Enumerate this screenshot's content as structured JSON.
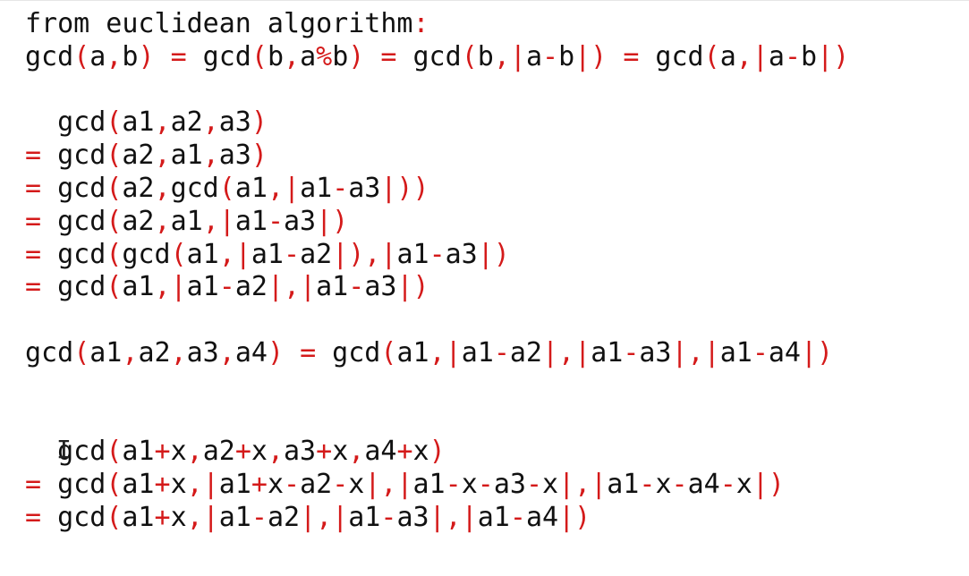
{
  "colors": {
    "background": "#ffffff",
    "text": "#111111",
    "operator": "#d41a1a"
  },
  "lines": [
    [
      {
        "t": "from euclidean algorithm",
        "c": "k"
      },
      {
        "t": ":",
        "c": "r"
      }
    ],
    [
      {
        "t": "gcd",
        "c": "k"
      },
      {
        "t": "(",
        "c": "r"
      },
      {
        "t": "a",
        "c": "k"
      },
      {
        "t": ",",
        "c": "r"
      },
      {
        "t": "b",
        "c": "k"
      },
      {
        "t": ")",
        "c": "r"
      },
      {
        "t": " ",
        "c": "k"
      },
      {
        "t": "=",
        "c": "r"
      },
      {
        "t": " gcd",
        "c": "k"
      },
      {
        "t": "(",
        "c": "r"
      },
      {
        "t": "b",
        "c": "k"
      },
      {
        "t": ",",
        "c": "r"
      },
      {
        "t": "a",
        "c": "k"
      },
      {
        "t": "%",
        "c": "r"
      },
      {
        "t": "b",
        "c": "k"
      },
      {
        "t": ")",
        "c": "r"
      },
      {
        "t": " ",
        "c": "k"
      },
      {
        "t": "=",
        "c": "r"
      },
      {
        "t": " gcd",
        "c": "k"
      },
      {
        "t": "(",
        "c": "r"
      },
      {
        "t": "b",
        "c": "k"
      },
      {
        "t": ",|",
        "c": "r"
      },
      {
        "t": "a",
        "c": "k"
      },
      {
        "t": "-",
        "c": "r"
      },
      {
        "t": "b",
        "c": "k"
      },
      {
        "t": "|)",
        "c": "r"
      },
      {
        "t": " ",
        "c": "k"
      },
      {
        "t": "=",
        "c": "r"
      },
      {
        "t": " gcd",
        "c": "k"
      },
      {
        "t": "(",
        "c": "r"
      },
      {
        "t": "a",
        "c": "k"
      },
      {
        "t": ",|",
        "c": "r"
      },
      {
        "t": "a",
        "c": "k"
      },
      {
        "t": "-",
        "c": "r"
      },
      {
        "t": "b",
        "c": "k"
      },
      {
        "t": "|)",
        "c": "r"
      }
    ],
    [],
    [
      {
        "t": "  gcd",
        "c": "k"
      },
      {
        "t": "(",
        "c": "r"
      },
      {
        "t": "a1",
        "c": "k"
      },
      {
        "t": ",",
        "c": "r"
      },
      {
        "t": "a2",
        "c": "k"
      },
      {
        "t": ",",
        "c": "r"
      },
      {
        "t": "a3",
        "c": "k"
      },
      {
        "t": ")",
        "c": "r"
      }
    ],
    [
      {
        "t": "=",
        "c": "r"
      },
      {
        "t": " gcd",
        "c": "k"
      },
      {
        "t": "(",
        "c": "r"
      },
      {
        "t": "a2",
        "c": "k"
      },
      {
        "t": ",",
        "c": "r"
      },
      {
        "t": "a1",
        "c": "k"
      },
      {
        "t": ",",
        "c": "r"
      },
      {
        "t": "a3",
        "c": "k"
      },
      {
        "t": ")",
        "c": "r"
      }
    ],
    [
      {
        "t": "=",
        "c": "r"
      },
      {
        "t": " gcd",
        "c": "k"
      },
      {
        "t": "(",
        "c": "r"
      },
      {
        "t": "a2",
        "c": "k"
      },
      {
        "t": ",",
        "c": "r"
      },
      {
        "t": "gcd",
        "c": "k"
      },
      {
        "t": "(",
        "c": "r"
      },
      {
        "t": "a1",
        "c": "k"
      },
      {
        "t": ",|",
        "c": "r"
      },
      {
        "t": "a1",
        "c": "k"
      },
      {
        "t": "-",
        "c": "r"
      },
      {
        "t": "a3",
        "c": "k"
      },
      {
        "t": "|))",
        "c": "r"
      }
    ],
    [
      {
        "t": "=",
        "c": "r"
      },
      {
        "t": " gcd",
        "c": "k"
      },
      {
        "t": "(",
        "c": "r"
      },
      {
        "t": "a2",
        "c": "k"
      },
      {
        "t": ",",
        "c": "r"
      },
      {
        "t": "a1",
        "c": "k"
      },
      {
        "t": ",|",
        "c": "r"
      },
      {
        "t": "a1",
        "c": "k"
      },
      {
        "t": "-",
        "c": "r"
      },
      {
        "t": "a3",
        "c": "k"
      },
      {
        "t": "|)",
        "c": "r"
      }
    ],
    [
      {
        "t": "=",
        "c": "r"
      },
      {
        "t": " gcd",
        "c": "k"
      },
      {
        "t": "(",
        "c": "r"
      },
      {
        "t": "gcd",
        "c": "k"
      },
      {
        "t": "(",
        "c": "r"
      },
      {
        "t": "a1",
        "c": "k"
      },
      {
        "t": ",|",
        "c": "r"
      },
      {
        "t": "a1",
        "c": "k"
      },
      {
        "t": "-",
        "c": "r"
      },
      {
        "t": "a2",
        "c": "k"
      },
      {
        "t": "|),|",
        "c": "r"
      },
      {
        "t": "a1",
        "c": "k"
      },
      {
        "t": "-",
        "c": "r"
      },
      {
        "t": "a3",
        "c": "k"
      },
      {
        "t": "|)",
        "c": "r"
      }
    ],
    [
      {
        "t": "=",
        "c": "r"
      },
      {
        "t": " gcd",
        "c": "k"
      },
      {
        "t": "(",
        "c": "r"
      },
      {
        "t": "a1",
        "c": "k"
      },
      {
        "t": ",|",
        "c": "r"
      },
      {
        "t": "a1",
        "c": "k"
      },
      {
        "t": "-",
        "c": "r"
      },
      {
        "t": "a2",
        "c": "k"
      },
      {
        "t": "|,|",
        "c": "r"
      },
      {
        "t": "a1",
        "c": "k"
      },
      {
        "t": "-",
        "c": "r"
      },
      {
        "t": "a3",
        "c": "k"
      },
      {
        "t": "|)",
        "c": "r"
      }
    ],
    [],
    [
      {
        "t": "gcd",
        "c": "k"
      },
      {
        "t": "(",
        "c": "r"
      },
      {
        "t": "a1",
        "c": "k"
      },
      {
        "t": ",",
        "c": "r"
      },
      {
        "t": "a2",
        "c": "k"
      },
      {
        "t": ",",
        "c": "r"
      },
      {
        "t": "a3",
        "c": "k"
      },
      {
        "t": ",",
        "c": "r"
      },
      {
        "t": "a4",
        "c": "k"
      },
      {
        "t": ")",
        "c": "r"
      },
      {
        "t": " ",
        "c": "k"
      },
      {
        "t": "=",
        "c": "r"
      },
      {
        "t": " gcd",
        "c": "k"
      },
      {
        "t": "(",
        "c": "r"
      },
      {
        "t": "a1",
        "c": "k"
      },
      {
        "t": ",|",
        "c": "r"
      },
      {
        "t": "a1",
        "c": "k"
      },
      {
        "t": "-",
        "c": "r"
      },
      {
        "t": "a2",
        "c": "k"
      },
      {
        "t": "|,|",
        "c": "r"
      },
      {
        "t": "a1",
        "c": "k"
      },
      {
        "t": "-",
        "c": "r"
      },
      {
        "t": "a3",
        "c": "k"
      },
      {
        "t": "|,|",
        "c": "r"
      },
      {
        "t": "a1",
        "c": "k"
      },
      {
        "t": "-",
        "c": "r"
      },
      {
        "t": "a4",
        "c": "k"
      },
      {
        "t": "|)",
        "c": "r"
      }
    ],
    [],
    [],
    [
      {
        "t": "  gcd",
        "c": "k"
      },
      {
        "t": "(",
        "c": "r"
      },
      {
        "t": "a1",
        "c": "k"
      },
      {
        "t": "+",
        "c": "r"
      },
      {
        "t": "x",
        "c": "k"
      },
      {
        "t": ",",
        "c": "r"
      },
      {
        "t": "a2",
        "c": "k"
      },
      {
        "t": "+",
        "c": "r"
      },
      {
        "t": "x",
        "c": "k"
      },
      {
        "t": ",",
        "c": "r"
      },
      {
        "t": "a3",
        "c": "k"
      },
      {
        "t": "+",
        "c": "r"
      },
      {
        "t": "x",
        "c": "k"
      },
      {
        "t": ",",
        "c": "r"
      },
      {
        "t": "a4",
        "c": "k"
      },
      {
        "t": "+",
        "c": "r"
      },
      {
        "t": "x",
        "c": "k"
      },
      {
        "t": ")",
        "c": "r"
      }
    ],
    [
      {
        "t": "=",
        "c": "r"
      },
      {
        "t": " gcd",
        "c": "k"
      },
      {
        "t": "(",
        "c": "r"
      },
      {
        "t": "a1",
        "c": "k"
      },
      {
        "t": "+",
        "c": "r"
      },
      {
        "t": "x",
        "c": "k"
      },
      {
        "t": ",|",
        "c": "r"
      },
      {
        "t": "a1",
        "c": "k"
      },
      {
        "t": "+",
        "c": "r"
      },
      {
        "t": "x",
        "c": "k"
      },
      {
        "t": "-",
        "c": "r"
      },
      {
        "t": "a2",
        "c": "k"
      },
      {
        "t": "-",
        "c": "r"
      },
      {
        "t": "x",
        "c": "k"
      },
      {
        "t": "|,|",
        "c": "r"
      },
      {
        "t": "a1",
        "c": "k"
      },
      {
        "t": "-",
        "c": "r"
      },
      {
        "t": "x",
        "c": "k"
      },
      {
        "t": "-",
        "c": "r"
      },
      {
        "t": "a3",
        "c": "k"
      },
      {
        "t": "-",
        "c": "r"
      },
      {
        "t": "x",
        "c": "k"
      },
      {
        "t": "|,|",
        "c": "r"
      },
      {
        "t": "a1",
        "c": "k"
      },
      {
        "t": "-",
        "c": "r"
      },
      {
        "t": "x",
        "c": "k"
      },
      {
        "t": "-",
        "c": "r"
      },
      {
        "t": "a4",
        "c": "k"
      },
      {
        "t": "-",
        "c": "r"
      },
      {
        "t": "x",
        "c": "k"
      },
      {
        "t": "|)",
        "c": "r"
      }
    ],
    [
      {
        "t": "=",
        "c": "r"
      },
      {
        "t": " gcd",
        "c": "k"
      },
      {
        "t": "(",
        "c": "r"
      },
      {
        "t": "a1",
        "c": "k"
      },
      {
        "t": "+",
        "c": "r"
      },
      {
        "t": "x",
        "c": "k"
      },
      {
        "t": ",|",
        "c": "r"
      },
      {
        "t": "a1",
        "c": "k"
      },
      {
        "t": "-",
        "c": "r"
      },
      {
        "t": "a2",
        "c": "k"
      },
      {
        "t": "|,|",
        "c": "r"
      },
      {
        "t": "a1",
        "c": "k"
      },
      {
        "t": "-",
        "c": "r"
      },
      {
        "t": "a3",
        "c": "k"
      },
      {
        "t": "|,|",
        "c": "r"
      },
      {
        "t": "a1",
        "c": "k"
      },
      {
        "t": "-",
        "c": "r"
      },
      {
        "t": "a4",
        "c": "k"
      },
      {
        "t": "|)",
        "c": "r"
      }
    ]
  ]
}
